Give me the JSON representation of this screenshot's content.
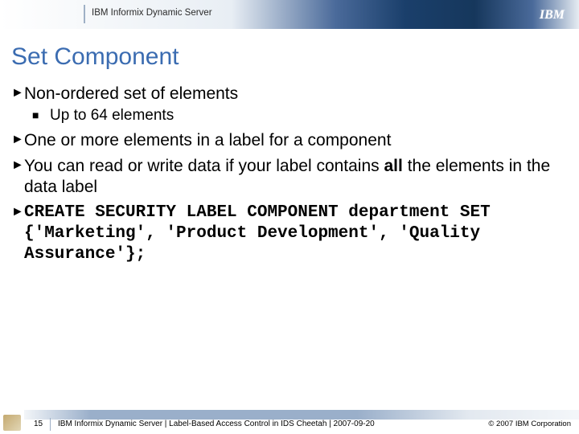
{
  "header": {
    "product": "IBM Informix Dynamic Server",
    "logo_text": "IBM"
  },
  "title": "Set Component",
  "bullets": [
    {
      "text": "Non-ordered set of elements",
      "sub": [
        {
          "text": "Up to 64 elements"
        }
      ]
    },
    {
      "text": "One or more elements in a label for a component"
    },
    {
      "text_html": "You can read or write data if your label contains <b>all</b> the elements in the data label"
    },
    {
      "code": "CREATE SECURITY LABEL COMPONENT department SET {'Marketing', 'Product Development', 'Quality Assurance'};"
    }
  ],
  "footer": {
    "page": "15",
    "text": "IBM Informix Dynamic Server | Label-Based Access Control in IDS Cheetah | 2007-09-20",
    "copyright": "© 2007 IBM Corporation"
  }
}
